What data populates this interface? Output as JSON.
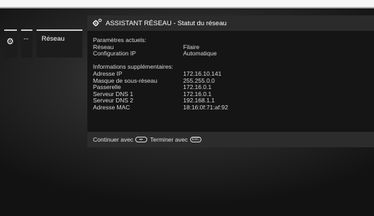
{
  "sidebar": {
    "tabs": [
      {
        "icon": "gear-icon",
        "glyph": "⚙"
      },
      {
        "icon": "more-icon",
        "glyph": "···"
      },
      {
        "label": "Réseau"
      }
    ]
  },
  "dialog": {
    "icon": "network-settings-icon",
    "title": "ASSISTANT RÉSEAU - Statut du réseau",
    "section1_heading": "Paramètres actuels:",
    "section1_rows": [
      {
        "key": "Réseau",
        "value": "Filaire"
      },
      {
        "key": "Configuration IP",
        "value": "Automatique"
      }
    ],
    "section2_heading": "Informations supplémentaires:",
    "section2_rows": [
      {
        "key": "Adresse IP",
        "value": "172.16.10.141"
      },
      {
        "key": "Masque de sous-réseau",
        "value": "255.255.0.0"
      },
      {
        "key": "Passerelle",
        "value": "172.16.0.1"
      },
      {
        "key": "Serveur DNS 1",
        "value": "172.16.0.1"
      },
      {
        "key": "Serveur DNS 2",
        "value": "192.168.1.1"
      },
      {
        "key": "Adresse MAC",
        "value": "18:16:0f:71:af:92"
      }
    ],
    "footer": {
      "continue_label": "Continuer avec",
      "continue_key": "▸▸",
      "finish_label": "Terminer avec",
      "finish_key": "ESC"
    }
  }
}
